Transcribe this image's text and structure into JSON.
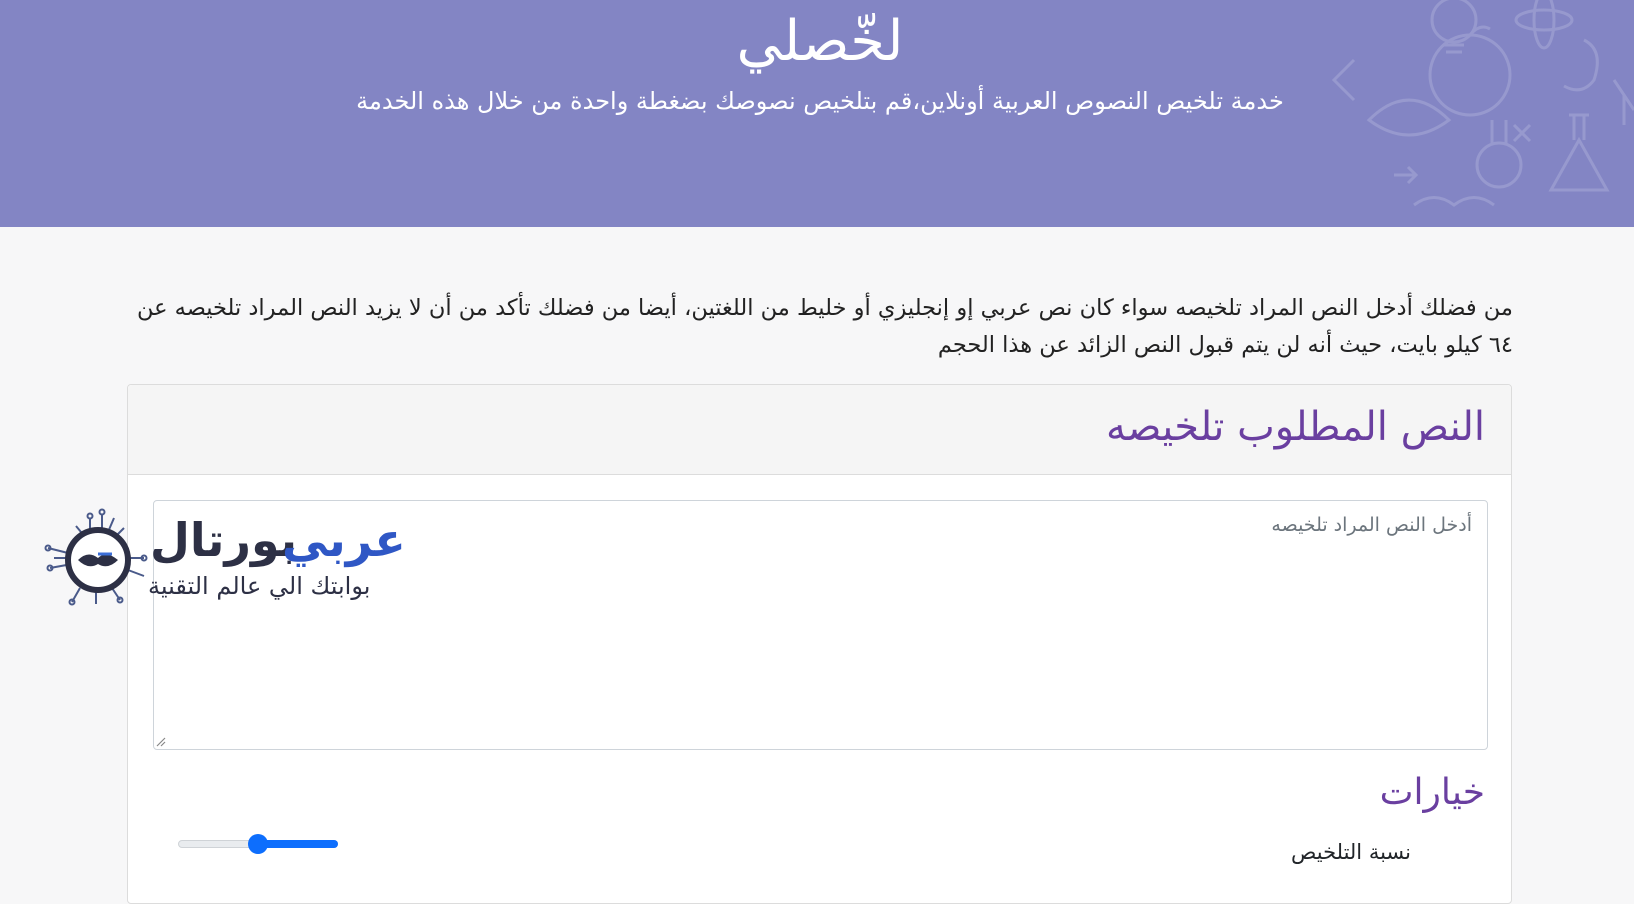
{
  "header": {
    "title": "لخّصلي",
    "subtitle": "خدمة تلخيص النصوص العربية أونلاين،قم بتلخيص نصوصك بضغطة واحدة من خلال هذه الخدمة",
    "background_color": "#8385c4"
  },
  "intro": {
    "text": "من فضلك أدخل النص المراد تلخيصه سواء كان نص عربي إو إنجليزي أو خليط من اللغتين، أيضا من فضلك تأكد من أن لا يزيد النص المراد تلخيصه عن ٦٤ كيلو بايت، حيث أنه لن يتم قبول النص الزائد عن هذا الحجم"
  },
  "card": {
    "title": "النص المطلوب تلخيصه",
    "textarea": {
      "value": "",
      "placeholder": "أدخل النص المراد تلخيصه"
    },
    "options_title": "خيارات",
    "summary_ratio": {
      "label": "نسبة التلخيص",
      "fraction": 0.5
    },
    "accent_color": "#6a3fa0"
  },
  "logo": {
    "word_dark": "بورتال",
    "word_blue": "عربي",
    "tagline": "بوابتك الي عالم التقنية",
    "icon": "handshake-circuit-icon"
  }
}
